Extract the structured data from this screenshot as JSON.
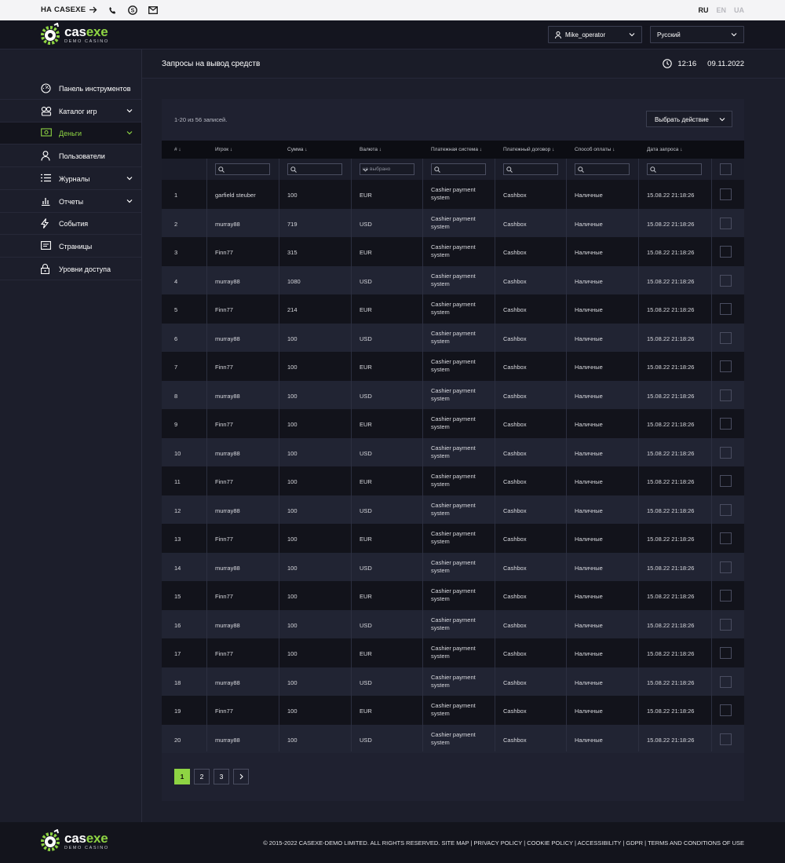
{
  "topbar": {
    "back_label": "НА CASEXE",
    "icons": [
      "phone-icon",
      "skype-icon",
      "mail-icon"
    ],
    "languages": [
      {
        "code": "RU",
        "active": true
      },
      {
        "code": "EN",
        "active": false
      },
      {
        "code": "UA",
        "active": false
      }
    ]
  },
  "header": {
    "logo": {
      "brand_pre": "cas",
      "brand_post": "exe",
      "sub": "DEMO CASINO"
    },
    "user": "Mike_operator",
    "language_select": "Русский"
  },
  "sidebar": {
    "items": [
      {
        "label": "Панель инструментов",
        "icon": "dashboard-icon",
        "chevron": false,
        "active": false
      },
      {
        "label": "Каталог игр",
        "icon": "games-icon",
        "chevron": true,
        "active": false
      },
      {
        "label": "Деньги",
        "icon": "money-icon",
        "chevron": true,
        "active": true
      },
      {
        "label": "Пользователи",
        "icon": "user-icon",
        "chevron": false,
        "active": false
      },
      {
        "label": "Журналы",
        "icon": "list-icon",
        "chevron": true,
        "active": false
      },
      {
        "label": "Отчеты",
        "icon": "chart-icon",
        "chevron": true,
        "active": false
      },
      {
        "label": "События",
        "icon": "lightning-icon",
        "chevron": false,
        "active": false
      },
      {
        "label": "Страницы",
        "icon": "page-icon",
        "chevron": false,
        "active": false
      },
      {
        "label": "Уровни доступа",
        "icon": "lock-icon",
        "chevron": false,
        "active": false
      }
    ]
  },
  "page": {
    "title": "Запросы на вывод средств",
    "time": "12:16",
    "date": "09.11.2022"
  },
  "table": {
    "count_text": "1-20 из 56 записей.",
    "action_label": "Выбрать действие",
    "currency_filter_placeholder": "не выбрано",
    "columns": [
      "# ↓",
      "Игрок ↓",
      "Сумма ↓",
      "Валюта ↓",
      "Платежная система ↓",
      "Платежный договор ↓",
      "Способ оплаты ↓",
      "Дата запроса ↓"
    ],
    "rows": [
      {
        "id": "1",
        "player": "garfield steuber",
        "amount": "100",
        "currency": "EUR",
        "system": "Cashier payment system",
        "contract": "Cashbox",
        "method": "Наличные",
        "date": "15.08.22  21:18:26"
      },
      {
        "id": "2",
        "player": "murray88",
        "amount": "719",
        "currency": "USD",
        "system": "Cashier payment system",
        "contract": "Cashbox",
        "method": "Наличные",
        "date": "15.08.22  21:18:26"
      },
      {
        "id": "3",
        "player": "Finn77",
        "amount": "315",
        "currency": "EUR",
        "system": "Cashier payment system",
        "contract": "Cashbox",
        "method": "Наличные",
        "date": "15.08.22  21:18:26"
      },
      {
        "id": "4",
        "player": "murray88",
        "amount": "1080",
        "currency": "USD",
        "system": "Cashier payment system",
        "contract": "Cashbox",
        "method": "Наличные",
        "date": "15.08.22  21:18:26"
      },
      {
        "id": "5",
        "player": "Finn77",
        "amount": "214",
        "currency": "EUR",
        "system": "Cashier payment system",
        "contract": "Cashbox",
        "method": "Наличные",
        "date": "15.08.22  21:18:26"
      },
      {
        "id": "6",
        "player": "murray88",
        "amount": "100",
        "currency": "USD",
        "system": "Cashier payment system",
        "contract": "Cashbox",
        "method": "Наличные",
        "date": "15.08.22  21:18:26"
      },
      {
        "id": "7",
        "player": "Finn77",
        "amount": "100",
        "currency": "EUR",
        "system": "Cashier payment system",
        "contract": "Cashbox",
        "method": "Наличные",
        "date": "15.08.22  21:18:26"
      },
      {
        "id": "8",
        "player": "murray88",
        "amount": "100",
        "currency": "USD",
        "system": "Cashier payment system",
        "contract": "Cashbox",
        "method": "Наличные",
        "date": "15.08.22  21:18:26"
      },
      {
        "id": "9",
        "player": "Finn77",
        "amount": "100",
        "currency": "EUR",
        "system": "Cashier payment system",
        "contract": "Cashbox",
        "method": "Наличные",
        "date": "15.08.22  21:18:26"
      },
      {
        "id": "10",
        "player": "murray88",
        "amount": "100",
        "currency": "USD",
        "system": "Cashier payment system",
        "contract": "Cashbox",
        "method": "Наличные",
        "date": "15.08.22  21:18:26"
      },
      {
        "id": "11",
        "player": "Finn77",
        "amount": "100",
        "currency": "EUR",
        "system": "Cashier payment system",
        "contract": "Cashbox",
        "method": "Наличные",
        "date": "15.08.22  21:18:26"
      },
      {
        "id": "12",
        "player": "murray88",
        "amount": "100",
        "currency": "USD",
        "system": "Cashier payment system",
        "contract": "Cashbox",
        "method": "Наличные",
        "date": "15.08.22  21:18:26"
      },
      {
        "id": "13",
        "player": "Finn77",
        "amount": "100",
        "currency": "EUR",
        "system": "Cashier payment system",
        "contract": "Cashbox",
        "method": "Наличные",
        "date": "15.08.22  21:18:26"
      },
      {
        "id": "14",
        "player": "murray88",
        "amount": "100",
        "currency": "USD",
        "system": "Cashier payment system",
        "contract": "Cashbox",
        "method": "Наличные",
        "date": "15.08.22  21:18:26"
      },
      {
        "id": "15",
        "player": "Finn77",
        "amount": "100",
        "currency": "EUR",
        "system": "Cashier payment system",
        "contract": "Cashbox",
        "method": "Наличные",
        "date": "15.08.22  21:18:26"
      },
      {
        "id": "16",
        "player": "murray88",
        "amount": "100",
        "currency": "USD",
        "system": "Cashier payment system",
        "contract": "Cashbox",
        "method": "Наличные",
        "date": "15.08.22  21:18:26"
      },
      {
        "id": "17",
        "player": "Finn77",
        "amount": "100",
        "currency": "EUR",
        "system": "Cashier payment system",
        "contract": "Cashbox",
        "method": "Наличные",
        "date": "15.08.22  21:18:26"
      },
      {
        "id": "18",
        "player": "murray88",
        "amount": "100",
        "currency": "USD",
        "system": "Cashier payment system",
        "contract": "Cashbox",
        "method": "Наличные",
        "date": "15.08.22  21:18:26"
      },
      {
        "id": "19",
        "player": "Finn77",
        "amount": "100",
        "currency": "EUR",
        "system": "Cashier payment system",
        "contract": "Cashbox",
        "method": "Наличные",
        "date": "15.08.22  21:18:26"
      },
      {
        "id": "20",
        "player": "murray88",
        "amount": "100",
        "currency": "USD",
        "system": "Cashier payment system",
        "contract": "Cashbox",
        "method": "Наличные",
        "date": "15.08.22  21:18:26"
      }
    ]
  },
  "pagination": {
    "pages": [
      "1",
      "2",
      "3"
    ],
    "current": "1",
    "next_icon": "chevron-right-icon"
  },
  "footer": {
    "copyright": "© 2015-2022 CASEXE-DEMO LIMITED. ALL RIGHTS RESERVED.  SITE MAP  |  PRIVACY POLICY  |  COOKIE POLICY  |  ACCESSIBILITY  |  GDPR  |  TERMS AND CONDITIONS OF USE"
  },
  "colors": {
    "accent": "#8ed443",
    "background": "#1c1e2b",
    "header": "#14151f",
    "row_dark": "#12131b",
    "row_light": "#212433"
  }
}
